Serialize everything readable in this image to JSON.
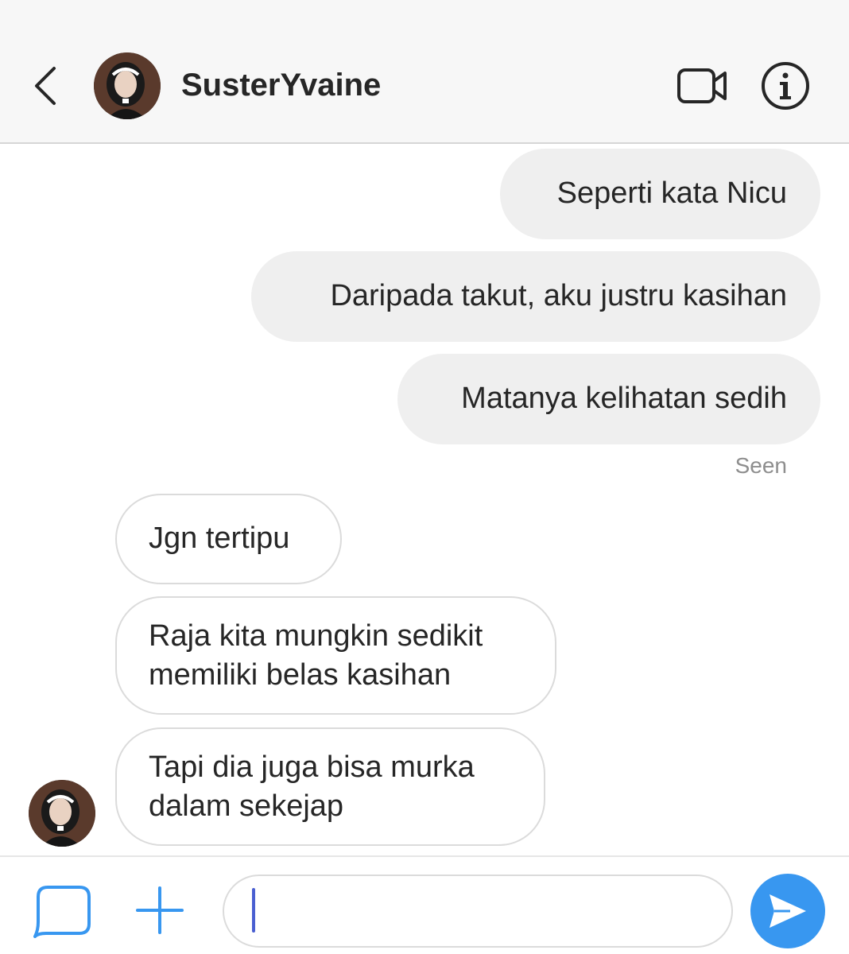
{
  "header": {
    "username": "SusterYvaine"
  },
  "messages": {
    "outgoing": [
      {
        "text": "Seperti kata Nicu"
      },
      {
        "text": "Daripada takut, aku justru kasihan"
      },
      {
        "text": "Matanya kelihatan sedih"
      }
    ],
    "seen_label": "Seen",
    "incoming": [
      {
        "lines": [
          "Jgn tertipu"
        ]
      },
      {
        "lines": [
          "Raja kita mungkin sedikit",
          "memiliki belas kasihan"
        ]
      },
      {
        "lines": [
          "Tapi dia juga bisa murka",
          "dalam sekejap"
        ]
      }
    ]
  },
  "composer": {
    "value": ""
  },
  "colors": {
    "send_button": "#3897f0",
    "composer_icons": "#3897f0",
    "outgoing_bubble": "#efefef",
    "seen_text": "#8e8e8e"
  },
  "icons": {
    "back": "chevron-left-icon",
    "video": "video-camera-icon",
    "info": "info-icon",
    "camera": "chat-bubble-icon",
    "plus": "plus-icon",
    "send": "send-arrow-icon"
  }
}
